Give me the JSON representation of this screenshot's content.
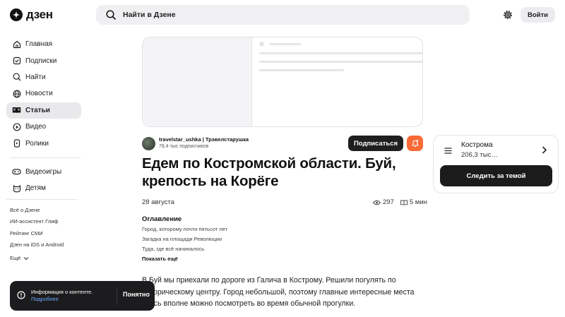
{
  "header": {
    "logo_text": "дзен",
    "search_placeholder": "Найти в Дзене",
    "login_label": "Войти"
  },
  "sidebar": {
    "items": [
      {
        "label": "Главная",
        "icon": "home-icon"
      },
      {
        "label": "Подписки",
        "icon": "subscriptions-icon"
      },
      {
        "label": "Найти",
        "icon": "search-icon"
      },
      {
        "label": "Новости",
        "icon": "news-icon"
      },
      {
        "label": "Статьи",
        "icon": "articles-icon",
        "active": true
      },
      {
        "label": "Видео",
        "icon": "video-icon"
      },
      {
        "label": "Ролики",
        "icon": "shorts-icon"
      }
    ],
    "items2": [
      {
        "label": "Видеоигры",
        "icon": "gamepad-icon"
      },
      {
        "label": "Детям",
        "icon": "kids-icon"
      }
    ],
    "footer_links": [
      "Всё о Дзене",
      "ИИ-ассистент Глиф",
      "Рейтинг СМИ",
      "Дзен на iOS и Android"
    ],
    "more_label": "Ещё"
  },
  "article": {
    "author_name": "travelstar_ushka | Трэвелстарушка",
    "author_subscribers": "78,4 тыс подписчиков",
    "subscribe_label": "Подписаться",
    "title": "Едем по Костромской области. Буй, крепость на Корёге",
    "date": "28 августа",
    "views": "297",
    "read_time": "5 мин",
    "toc_heading": "Оглавление",
    "toc_items": [
      "Город, которому почти пятьсот лет",
      "Загадка на площади Революции",
      "Туда, где всё начиналось"
    ],
    "toc_more": "Показать ещё",
    "paragraph": "В Буй мы приехали по дороге из Галича в Кострому. Решили погулять по историческому центру. Город небольшой, поэтому главные интересные места здесь вполне можно посмотреть во время обычной прогулки."
  },
  "topic": {
    "name": "Кострома",
    "count": "206,3 тыс…",
    "follow_label": "Следить за темой"
  },
  "toast": {
    "text": "Информация о контенте.",
    "link": "Подробнее",
    "ok_label": "Понятно"
  },
  "colors": {
    "accent_orange": "#fa6a37",
    "dark_button": "#1f1f1f",
    "active_nav_bg": "#e9e9ec",
    "link_blue": "#6aa8ff"
  }
}
